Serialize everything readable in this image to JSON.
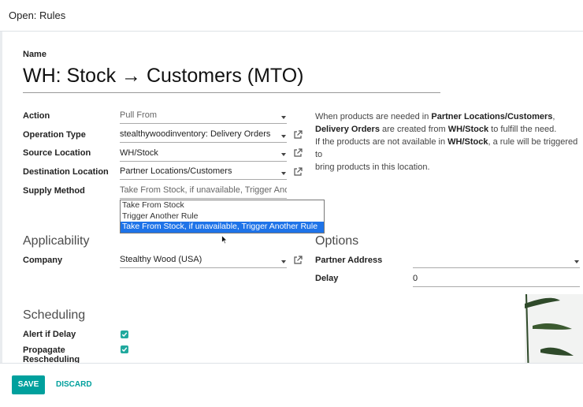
{
  "dialog": {
    "title": "Open: Rules"
  },
  "form": {
    "name_label": "Name",
    "name_value": "WH: Stock → Customers (MTO)",
    "fields": {
      "action": {
        "label": "Action",
        "value": "Pull From"
      },
      "operation_type": {
        "label": "Operation Type",
        "value": "stealthywoodinventory: Delivery Orders"
      },
      "source_location": {
        "label": "Source Location",
        "value": "WH/Stock"
      },
      "destination_location": {
        "label": "Destination Location",
        "value": "Partner Locations/Customers"
      },
      "supply_method": {
        "label": "Supply Method",
        "value": "Take From Stock, if unavailable, Trigger Another Rule"
      }
    },
    "help": {
      "p1_a": "When products are needed in ",
      "p1_b": "Partner Locations/Customers",
      "p1_c": ",",
      "p2_a": "Delivery Orders",
      "p2_b": " are created from ",
      "p2_c": "WH/Stock",
      "p2_d": " to fulfill the need.",
      "p3_a": "If the products are not available in ",
      "p3_b": "WH/Stock",
      "p3_c": ", a rule will be triggered to",
      "p4": "bring products in this location."
    },
    "supply_options": [
      "Take From Stock",
      "Trigger Another Rule",
      "Take From Stock, if unavailable, Trigger Another Rule"
    ],
    "applicability": {
      "title": "Applicability",
      "company_label": "Company",
      "company_value": "Stealthy Wood (USA)"
    },
    "options": {
      "title": "Options",
      "partner_address_label": "Partner Address",
      "partner_address_value": "",
      "delay_label": "Delay",
      "delay_value": "0"
    },
    "scheduling": {
      "title": "Scheduling",
      "alert_label": "Alert if Delay",
      "propagate_label_1": "Propagate",
      "propagate_label_2": "Rescheduling"
    }
  },
  "footer": {
    "save_label": "SAVE",
    "discard_label": "DISCARD"
  },
  "colors": {
    "accent": "#00a09d",
    "selection": "#1e73e8",
    "checkbox": "#21a99e"
  }
}
